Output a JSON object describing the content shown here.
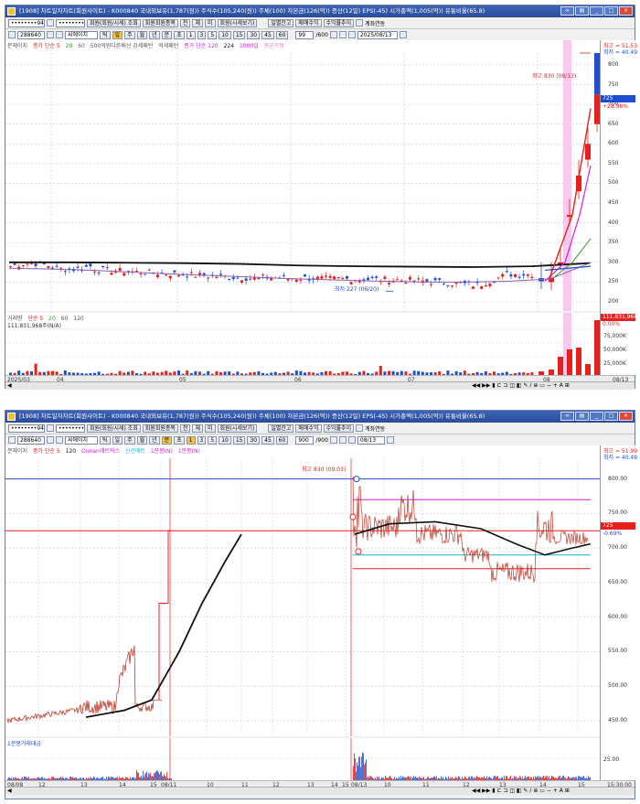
{
  "window1": {
    "title": "[1908] 차트일자차트(회원사이트) - K000840 국내외보유(1,787(원)) 주식수(105,240(원)) 주체(100) 자본금(126(억)) 증산(12일) EPS(-45) 시가총액(1,005(억)) 유통비율(65.8)",
    "toolbar1": {
      "account": "••••••••94",
      "password": "••••••••",
      "buttons": [
        "회원(회원/시세) 조회",
        "회원회원종목",
        "전",
        "체",
        "미",
        "회원(시세보기)",
        "일별잔고",
        "매매수익",
        "수익률추이",
        "계좌연동"
      ]
    },
    "toolbar2": {
      "code": "288640",
      "name": "씨에이치",
      "periods": [
        "틱",
        "일",
        "주",
        "월",
        "년",
        "분",
        "초",
        "틱"
      ],
      "intervals": [
        "1",
        "3",
        "5",
        "10",
        "15",
        "30",
        "45",
        "60"
      ],
      "count": "99",
      "total": "/600",
      "date": "2025/08/13"
    },
    "legend": [
      "분체이지",
      "종가 단순 5",
      "20",
      "60",
      "500억원다른배선 강세패턴",
      "억세패턴",
      "종가 단순 120",
      "224",
      "1000일",
      "평균가정"
    ],
    "high_label": "최고 830 (08/13)",
    "low_label": "최저 227 (06/20)",
    "volume_legend": [
      "거래량",
      "단순 5",
      "20",
      "60",
      "120"
    ],
    "volume_value": "111,831,968주(N/A)",
    "price_box": "725",
    "price_change": "+28.98%",
    "volume_box": "111,831,968",
    "volume_pct": "0.00%",
    "price_axis": [
      "800",
      "750",
      "700",
      "650",
      "600",
      "550",
      "500",
      "450",
      "400",
      "350",
      "300",
      "250",
      "200"
    ],
    "volume_axis": [
      "75,000K",
      "50,000K",
      "25,000K"
    ],
    "top_right": [
      "최고 = 51.53",
      "최저 = 40.49"
    ],
    "months": [
      "2025/03",
      "04",
      "05",
      "06",
      "07",
      "08"
    ],
    "date_corner": "08/13"
  },
  "window2": {
    "title": "[1908] 차트일자차트(회원사이트) - K000840 국내외보유(1,787(원)) 주식수(105,240(원)) 주체(100) 자본금(126(억)) 증산(12일) EPS(-45) 시가총액(1,005(억)) 유통비율(65.8)",
    "toolbar1": {
      "account": "••••••••94",
      "password": "••••••••",
      "buttons": [
        "회원(회원/시세) 조회",
        "회원회원종목",
        "전",
        "체",
        "미",
        "회원(시세보기)",
        "일별잔고",
        "매매수익",
        "수익률추이",
        "계좌연동"
      ]
    },
    "toolbar2": {
      "code": "288640",
      "name": "씨에이치",
      "periods": [
        "틱",
        "일",
        "주",
        "월",
        "년",
        "분",
        "초",
        "틱"
      ],
      "intervals": [
        "1",
        "3",
        "5",
        "10",
        "15",
        "30",
        "45",
        "60"
      ],
      "count": "900",
      "total": "/900",
      "date": "08/13"
    },
    "legend": [
      "분체이지",
      "종가 단순 5",
      "120",
      "Ounan매트릭스",
      "신선매트",
      "1분봉(N)",
      "1분봉(N)"
    ],
    "high_label": "최고 830 (09:03)",
    "volume_legend": [
      "1분봉거래대금"
    ],
    "price_box": "725",
    "price_change": "-0.69%",
    "price_axis": [
      "800.00",
      "750.00",
      "700.00",
      "650.00",
      "600.00",
      "550.00",
      "500.00",
      "450.00"
    ],
    "volume_axis": [
      "25.00"
    ],
    "top_right": [
      "최고 = 51.99",
      "최저 = 40.49"
    ],
    "times": [
      "08/08",
      "12",
      "13",
      "14",
      "15",
      "08/11",
      "10",
      "11",
      "12",
      "13",
      "14",
      "15",
      "08/13",
      "10",
      "11",
      "12",
      "13",
      "14",
      "15"
    ],
    "time_corner": "15:30:00"
  },
  "colors": {
    "up": "#e8201c",
    "down": "#1f4fd0",
    "title_bar": "#2f55a8",
    "pink_band": "#f7c9ec",
    "ma_black": "#111111",
    "ma_magenta": "#d020d8"
  },
  "chart_data": [
    {
      "type": "candlestick",
      "title": "",
      "x_label": "",
      "y_label": "",
      "ylim": [
        200,
        830
      ],
      "grid": true,
      "series": [
        {
          "name": "종가 단순 120",
          "values": [
            300,
            300,
            299,
            298,
            296,
            292,
            290,
            289,
            288,
            290,
            298
          ]
        },
        {
          "name": "종가 단순 20",
          "values": [
            285,
            282,
            278,
            272,
            268,
            262,
            258,
            255,
            252,
            255,
            360
          ]
        }
      ],
      "close_prices": [
        290,
        295,
        300,
        285,
        280,
        275,
        270,
        265,
        262,
        260,
        258,
        255,
        250,
        248,
        252,
        260,
        300,
        420,
        520,
        600,
        725
      ],
      "high": 830,
      "low": 227
    },
    {
      "type": "line",
      "title": "",
      "x_label": "",
      "y_label": "",
      "ylim": [
        440,
        830
      ],
      "grid": true,
      "series": [
        {
          "name": "1분봉(N)",
          "values": [
            455,
            460,
            470,
            480,
            500,
            520,
            550,
            600,
            680,
            725,
            740,
            745,
            730,
            700,
            690,
            700,
            730,
            725
          ]
        }
      ]
    }
  ]
}
